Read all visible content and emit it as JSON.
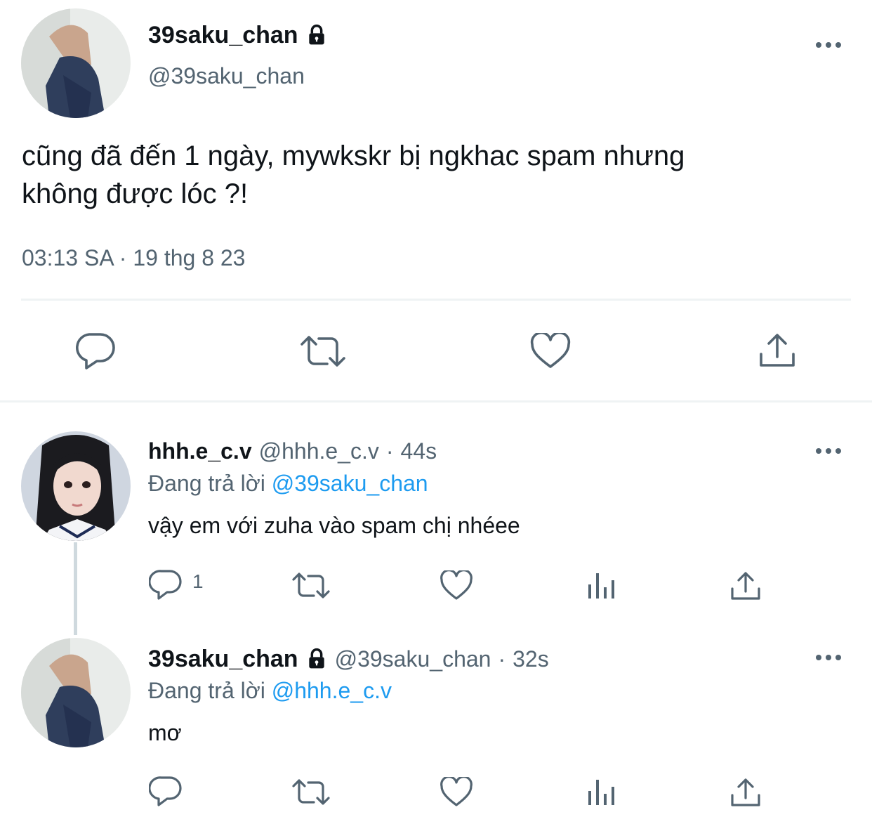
{
  "main_tweet": {
    "display_name": "39saku_chan",
    "handle": "@39saku_chan",
    "text_line1": "cũng đã đến 1 ngày, mywkskr bị ngkhac spam nhưng",
    "text_line2": "không được lóc ?!",
    "time": "03:13 SA",
    "separator": "·",
    "date": "19 thg 8 23"
  },
  "replies": [
    {
      "display_name": "hhh.e_c.v",
      "handle": "@hhh.e_c.v",
      "separator": "·",
      "time": "44s",
      "replying_prefix": "Đang trả lời",
      "replying_to": "@39saku_chan",
      "text": "vậy em với zuha vào spam chị nhéee",
      "reply_count": "1"
    },
    {
      "display_name": "39saku_chan",
      "handle": "@39saku_chan",
      "separator": "·",
      "time": "32s",
      "replying_prefix": "Đang trả lời",
      "replying_to": "@hhh.e_c.v",
      "text": "mơ",
      "reply_count": ""
    }
  ],
  "icons": {
    "reply": "reply-icon",
    "retweet": "retweet-icon",
    "like": "heart-icon",
    "views": "views-icon",
    "share": "share-icon",
    "more": "more-icon",
    "protected": "lock-icon"
  },
  "colors": {
    "text": "#0f1419",
    "muted": "#536471",
    "link": "#1d9bf0",
    "divider": "#eff3f4"
  }
}
